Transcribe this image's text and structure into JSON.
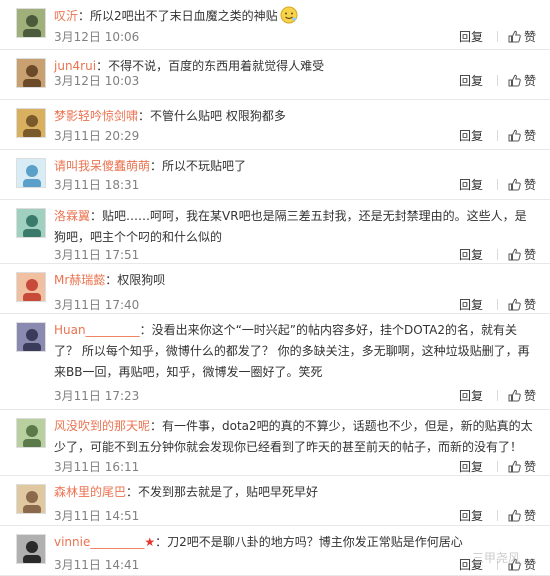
{
  "actions": {
    "reply_label": "回复",
    "like_label": "赞"
  },
  "comments": [
    {
      "user": "叹沂",
      "text": "：所以2吧出不了末日血魔之类的神贴",
      "time": "3月12日 10:06"
    },
    {
      "user": "jun4rui",
      "text": "：不得不说，百度的东西用着就觉得人难受",
      "time": "3月12日 10:03"
    },
    {
      "user": "梦影轻吟惊剑啸",
      "text": "：不管什么贴吧 权限狗都多",
      "time": "3月11日 20:29"
    },
    {
      "user": "请叫我呆傻蠢萌萌",
      "text": "：所以不玩贴吧了",
      "time": "3月11日 18:31"
    },
    {
      "user": "洛霖翼",
      "text": "：贴吧……呵呵，我在某VR吧也是隔三差五封我，还是无封禁理由的。这些人，是狗吧，吧主个个叼的和什么似的",
      "time": "3月11日 17:51"
    },
    {
      "user": "Mr赫瑞懿",
      "text": "：权限狗呗",
      "time": "3月11日 17:40"
    },
    {
      "user": "Huan_________",
      "text": "：没看出来你这个“一时兴起”的帖内容多好，挂个DOTA2的名，就有关了？ 所以每个知乎，微博什么的都发了？ 你的多缺关注，多无聊啊，这种垃圾贴删了，再来BB一回，再贴吧，知乎，微博发一圈好了。笑死",
      "time": "3月11日 17:23"
    },
    {
      "user": "风没吹到的那天呢",
      "text": "：有一件事，dota2吧的真的不算少，话题也不少，但是，新的贴真的太少了，可能不到五分钟你就会发现你已经看到了昨天的甚至前天的帖子，而新的没有了！",
      "time": "3月11日 16:11"
    },
    {
      "user": "森林里的尾巴",
      "text": "：不发到那去就是了，贴吧早死早好",
      "time": "3月11日 14:51"
    },
    {
      "user": "vinnie_________",
      "badge": "★",
      "text": "：刀2吧不是聊八卦的地方吗？博主你发正常贴是作何居心",
      "time": "3月11日 14:41"
    }
  ],
  "watermark": "三甲尧风"
}
